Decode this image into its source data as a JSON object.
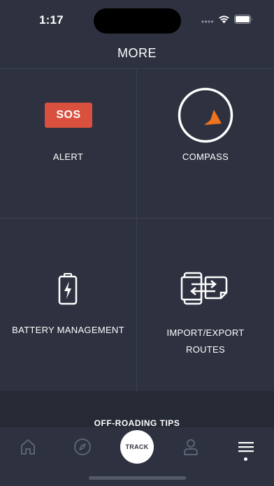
{
  "status_bar": {
    "time": "1:17",
    "icons": [
      "signal-dots-icon",
      "wifi-icon",
      "battery-icon"
    ]
  },
  "header": {
    "title": "MORE"
  },
  "grid": {
    "items": [
      {
        "id": "alert",
        "badge": "SOS",
        "label": "ALERT",
        "icon": "sos-badge"
      },
      {
        "id": "compass",
        "label": "COMPASS",
        "icon": "compass-icon"
      },
      {
        "id": "battery",
        "label": "BATTERY MANAGEMENT",
        "icon": "battery-charging-icon"
      },
      {
        "id": "import_export",
        "label_line1": "IMPORT/EXPORT",
        "label_line2": "ROUTES",
        "icon": "import-export-icon"
      }
    ]
  },
  "tips": {
    "label": "OFF-ROADING TIPS"
  },
  "tab_bar": {
    "tabs": [
      {
        "id": "home",
        "icon": "home-icon"
      },
      {
        "id": "compass",
        "icon": "compass-nav-icon"
      },
      {
        "id": "track",
        "label": "TRACK"
      },
      {
        "id": "profile",
        "icon": "profile-icon"
      },
      {
        "id": "menu",
        "icon": "menu-icon",
        "active": true
      }
    ]
  },
  "colors": {
    "background": "#2e3240",
    "sos_red": "#d9503f",
    "compass_orange": "#f0731e",
    "tips_bar": "#262a35"
  }
}
